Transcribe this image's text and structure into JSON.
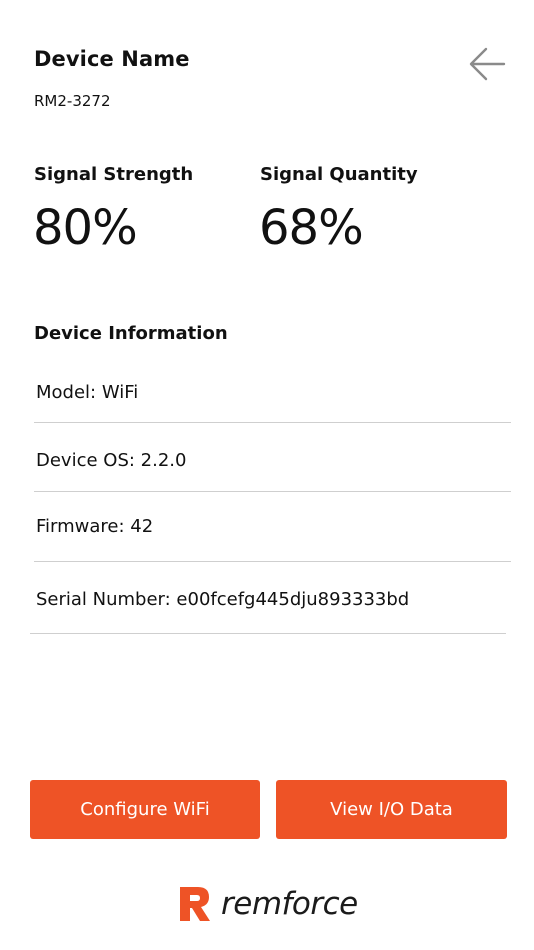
{
  "header": {
    "title": "Device Name",
    "device_id": "RM2-3272",
    "back_icon": "arrow-left-icon"
  },
  "signal": {
    "strength_label": "Signal Strength",
    "strength_value": "80%",
    "quantity_label": "Signal Quantity",
    "quantity_value": "68%"
  },
  "device_info": {
    "title": "Device Information",
    "rows": [
      "Model: WiFi",
      "Device OS: 2.2.0",
      "Firmware: 42",
      "Serial Number: e00fcefg445dju893333bd"
    ]
  },
  "actions": {
    "configure_label": "Configure WiFi",
    "view_io_label": "View I/O Data"
  },
  "brand": {
    "name": "remforce",
    "accent_color": "#ee5326"
  }
}
